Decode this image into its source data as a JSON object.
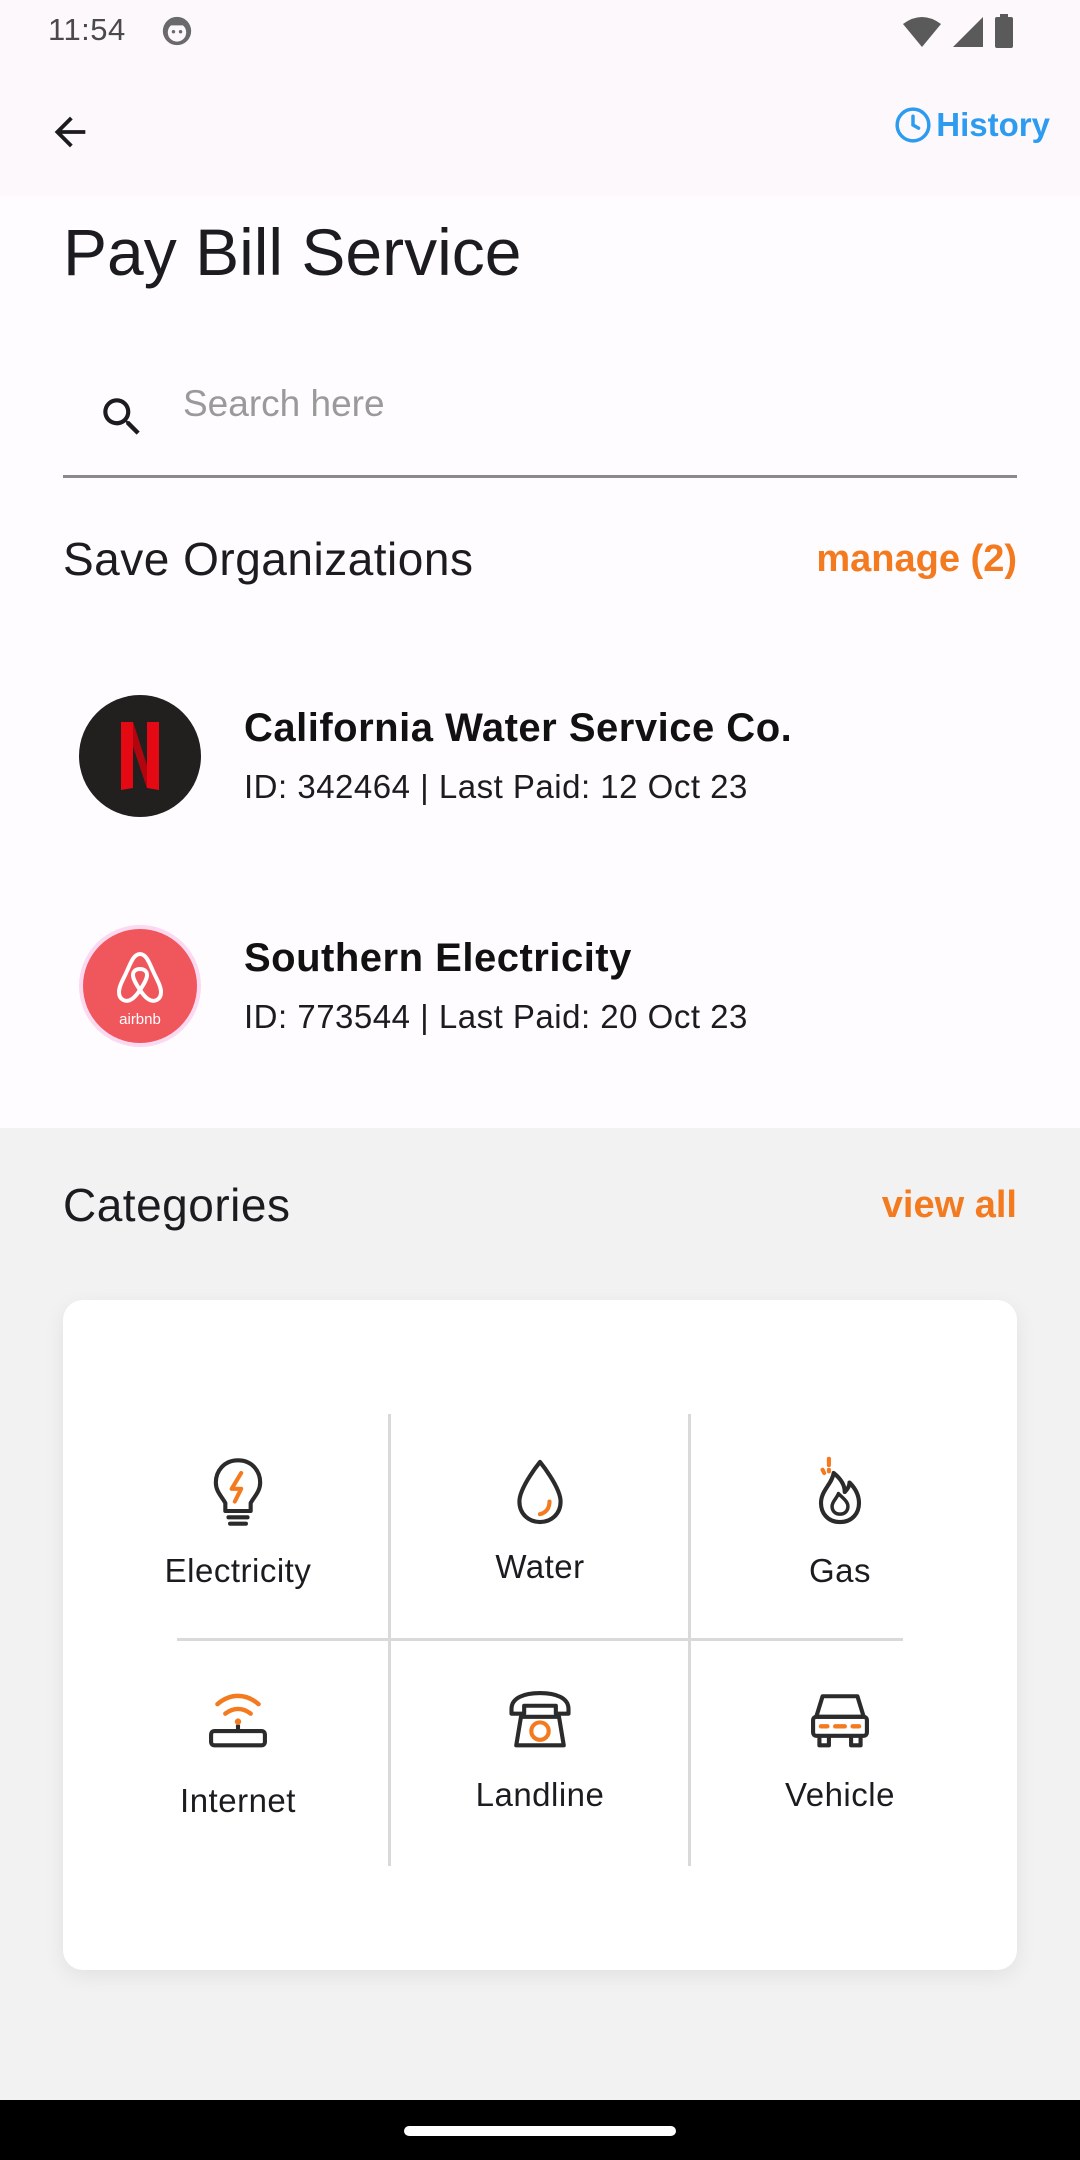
{
  "status_bar": {
    "time": "11:54"
  },
  "app_bar": {
    "history_label": "History"
  },
  "page": {
    "title": "Pay Bill Service"
  },
  "search": {
    "placeholder": "Search here",
    "value": ""
  },
  "saved_orgs": {
    "title": "Save Organizations",
    "manage_label": "manage (2)",
    "items": [
      {
        "name": "California Water Service Co.",
        "details": "ID: 342464 | Last Paid: 12 Oct 23",
        "logo_icon": "netflix-logo"
      },
      {
        "name": "Southern Electricity",
        "details": "ID: 773544 | Last Paid: 20 Oct 23",
        "logo_icon": "airbnb-logo",
        "logo_text": "airbnb"
      }
    ]
  },
  "categories": {
    "title": "Categories",
    "view_all_label": "view all",
    "items": [
      {
        "label": "Electricity",
        "icon": "lightbulb-icon"
      },
      {
        "label": "Water",
        "icon": "water-drop-icon"
      },
      {
        "label": "Gas",
        "icon": "flame-icon"
      },
      {
        "label": "Internet",
        "icon": "router-icon"
      },
      {
        "label": "Landline",
        "icon": "telephone-icon"
      },
      {
        "label": "Vehicle",
        "icon": "car-icon"
      }
    ]
  },
  "colors": {
    "accent_orange": "#f47a20",
    "link_blue": "#2d9cf0"
  }
}
